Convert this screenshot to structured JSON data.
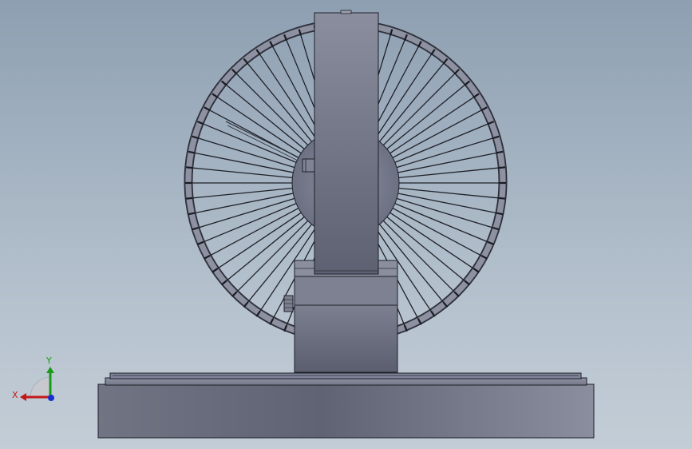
{
  "viewport": {
    "background_top": "#8d9fb1",
    "background_bottom": "#c3cdd6"
  },
  "triad": {
    "x_label": "X",
    "y_label": "Y",
    "x_color": "#c41818",
    "y_color": "#1a9a1a",
    "z_color": "#1a2ed0"
  },
  "model": {
    "spoke_count": 64,
    "body_color": "#6b6f80",
    "edge_color": "#1e2028"
  }
}
